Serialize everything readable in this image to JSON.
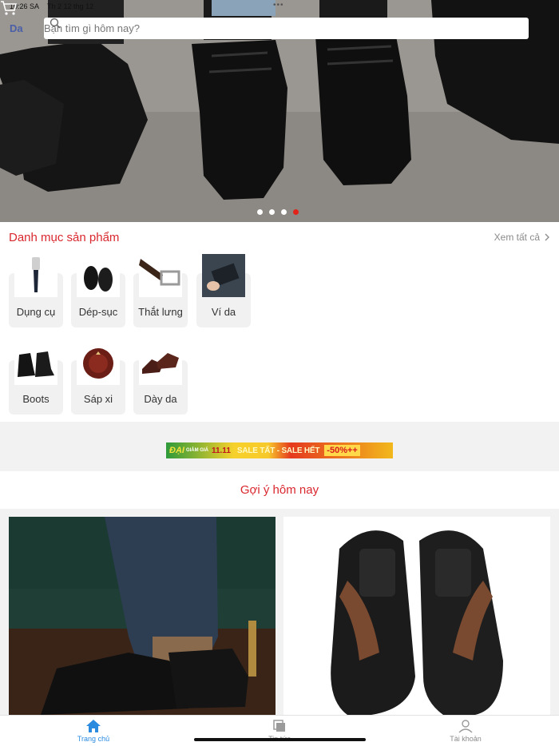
{
  "status_bar": {
    "time": "10:26 SA",
    "date": "Th 2 12 thg 12"
  },
  "header": {
    "logo": "Da",
    "search_placeholder": "Bạn tìm gì hôm nay?",
    "cart_icon": "cart-icon",
    "search_icon": "search-icon"
  },
  "carousel": {
    "count": 4,
    "active_index": 3
  },
  "categories": {
    "title": "Danh mục sản phẩm",
    "see_all": "Xem tất cả",
    "items": [
      {
        "label": "Dụng cụ"
      },
      {
        "label": "Dép-sục"
      },
      {
        "label": "Thắt lưng"
      },
      {
        "label": "Ví da"
      },
      {
        "label": "Boots"
      },
      {
        "label": "Sáp xi"
      },
      {
        "label": "Dày da"
      }
    ]
  },
  "banner": {
    "part1": "ĐẠI",
    "part2": "GIẢM GIÁ",
    "part3": "11.11",
    "part4": "SALE TẤT - SALE HẾT",
    "part5": "-50%++"
  },
  "suggestions": {
    "title": "Gợi ý hôm nay"
  },
  "tabbar": {
    "items": [
      {
        "label": "Trang chủ",
        "icon": "home-icon",
        "active": true
      },
      {
        "label": "Tin tức",
        "icon": "news-icon",
        "active": false
      },
      {
        "label": "Tài khoản",
        "icon": "account-icon",
        "active": false
      }
    ]
  },
  "colors": {
    "accent": "#d9272e",
    "active_tab": "#2a8bdf",
    "dot_active": "#e2231a"
  }
}
